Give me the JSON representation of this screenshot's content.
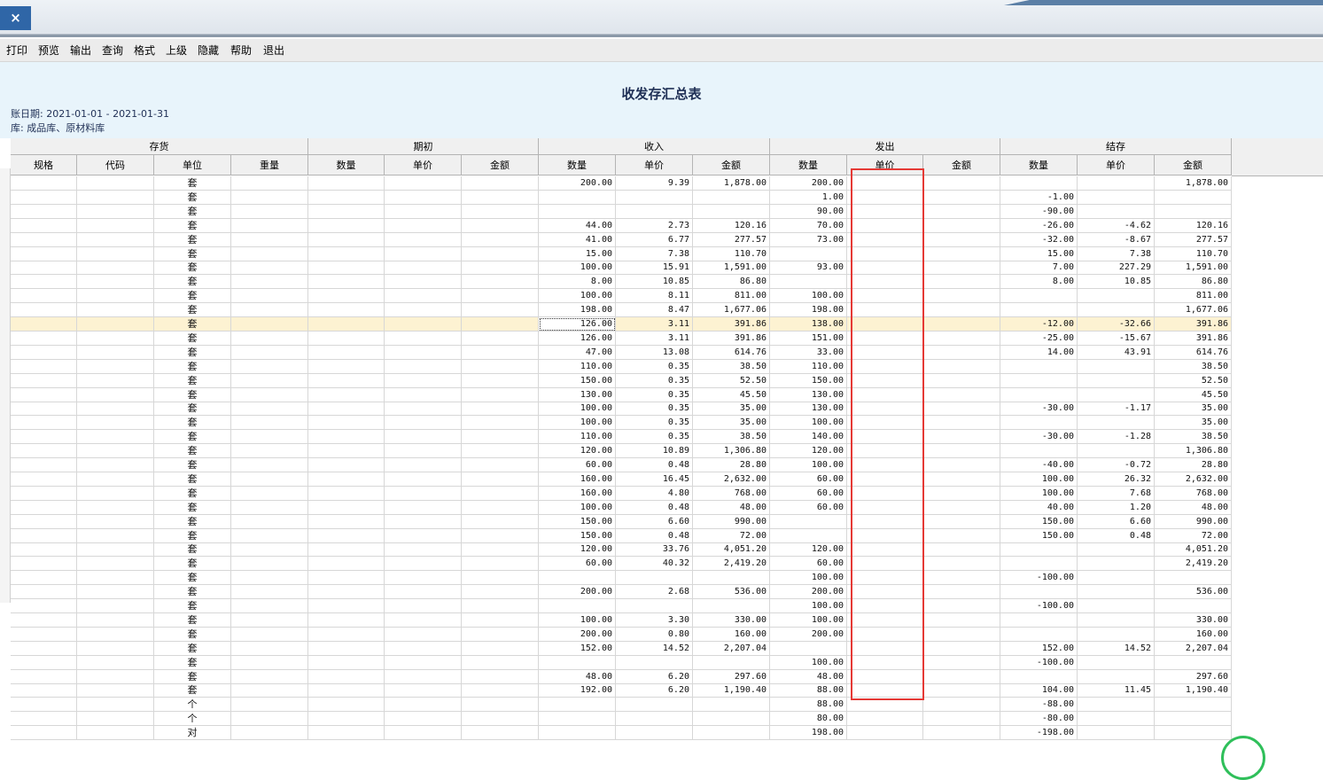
{
  "window": {
    "close_label": "×"
  },
  "toolbar": [
    {
      "label": "打印",
      "name": "toolbar-print"
    },
    {
      "label": "预览",
      "name": "toolbar-preview"
    },
    {
      "label": "输出",
      "name": "toolbar-export"
    },
    {
      "label": "查询",
      "name": "toolbar-query"
    },
    {
      "label": "格式",
      "name": "toolbar-format"
    },
    {
      "label": "上级",
      "name": "toolbar-parent"
    },
    {
      "label": "隐藏",
      "name": "toolbar-hide"
    },
    {
      "label": "帮助",
      "name": "toolbar-help"
    },
    {
      "label": "退出",
      "name": "toolbar-exit"
    }
  ],
  "report": {
    "title": "收发存汇总表",
    "date_line": "账日期: 2021-01-01 - 2021-01-31",
    "warehouse_line": "库: 成品库、原材料库"
  },
  "table": {
    "groups": [
      "存货",
      "期初",
      "收入",
      "发出",
      "结存"
    ],
    "columns": [
      "规格",
      "代码",
      "单位",
      "重量",
      "数量",
      "单价",
      "金额",
      "数量",
      "单价",
      "金额",
      "数量",
      "单价",
      "金额",
      "数量",
      "单价",
      "金额"
    ],
    "rows": [
      [
        "",
        "",
        "套",
        "",
        "",
        "",
        "",
        "200.00",
        "9.39",
        "1,878.00",
        "200.00",
        "",
        "",
        "",
        "",
        "1,878.00"
      ],
      [
        "",
        "",
        "套",
        "",
        "",
        "",
        "",
        "",
        "",
        "",
        "1.00",
        "",
        "",
        "-1.00",
        "",
        ""
      ],
      [
        "",
        "",
        "套",
        "",
        "",
        "",
        "",
        "",
        "",
        "",
        "90.00",
        "",
        "",
        "-90.00",
        "",
        ""
      ],
      [
        "",
        "",
        "套",
        "",
        "",
        "",
        "",
        "44.00",
        "2.73",
        "120.16",
        "70.00",
        "",
        "",
        "-26.00",
        "-4.62",
        "120.16"
      ],
      [
        "",
        "",
        "套",
        "",
        "",
        "",
        "",
        "41.00",
        "6.77",
        "277.57",
        "73.00",
        "",
        "",
        "-32.00",
        "-8.67",
        "277.57"
      ],
      [
        "",
        "",
        "套",
        "",
        "",
        "",
        "",
        "15.00",
        "7.38",
        "110.70",
        "",
        "",
        "",
        "15.00",
        "7.38",
        "110.70"
      ],
      [
        "",
        "",
        "套",
        "",
        "",
        "",
        "",
        "100.00",
        "15.91",
        "1,591.00",
        "93.00",
        "",
        "",
        "7.00",
        "227.29",
        "1,591.00"
      ],
      [
        "",
        "",
        "套",
        "",
        "",
        "",
        "",
        "8.00",
        "10.85",
        "86.80",
        "",
        "",
        "",
        "8.00",
        "10.85",
        "86.80"
      ],
      [
        "",
        "",
        "套",
        "",
        "",
        "",
        "",
        "100.00",
        "8.11",
        "811.00",
        "100.00",
        "",
        "",
        "",
        "",
        "811.00"
      ],
      [
        "",
        "",
        "套",
        "",
        "",
        "",
        "",
        "198.00",
        "8.47",
        "1,677.06",
        "198.00",
        "",
        "",
        "",
        "",
        "1,677.06"
      ],
      [
        "",
        "",
        "套",
        "",
        "",
        "",
        "",
        "126.00",
        "3.11",
        "391.86",
        "138.00",
        "",
        "",
        "-12.00",
        "-32.66",
        "391.86"
      ],
      [
        "",
        "",
        "套",
        "",
        "",
        "",
        "",
        "126.00",
        "3.11",
        "391.86",
        "151.00",
        "",
        "",
        "-25.00",
        "-15.67",
        "391.86"
      ],
      [
        "",
        "",
        "套",
        "",
        "",
        "",
        "",
        "47.00",
        "13.08",
        "614.76",
        "33.00",
        "",
        "",
        "14.00",
        "43.91",
        "614.76"
      ],
      [
        "",
        "",
        "套",
        "",
        "",
        "",
        "",
        "110.00",
        "0.35",
        "38.50",
        "110.00",
        "",
        "",
        "",
        "",
        "38.50"
      ],
      [
        "",
        "",
        "套",
        "",
        "",
        "",
        "",
        "150.00",
        "0.35",
        "52.50",
        "150.00",
        "",
        "",
        "",
        "",
        "52.50"
      ],
      [
        "",
        "",
        "套",
        "",
        "",
        "",
        "",
        "130.00",
        "0.35",
        "45.50",
        "130.00",
        "",
        "",
        "",
        "",
        "45.50"
      ],
      [
        "",
        "",
        "套",
        "",
        "",
        "",
        "",
        "100.00",
        "0.35",
        "35.00",
        "130.00",
        "",
        "",
        "-30.00",
        "-1.17",
        "35.00"
      ],
      [
        "",
        "",
        "套",
        "",
        "",
        "",
        "",
        "100.00",
        "0.35",
        "35.00",
        "100.00",
        "",
        "",
        "",
        "",
        "35.00"
      ],
      [
        "",
        "",
        "套",
        "",
        "",
        "",
        "",
        "110.00",
        "0.35",
        "38.50",
        "140.00",
        "",
        "",
        "-30.00",
        "-1.28",
        "38.50"
      ],
      [
        "",
        "",
        "套",
        "",
        "",
        "",
        "",
        "120.00",
        "10.89",
        "1,306.80",
        "120.00",
        "",
        "",
        "",
        "",
        "1,306.80"
      ],
      [
        "",
        "",
        "套",
        "",
        "",
        "",
        "",
        "60.00",
        "0.48",
        "28.80",
        "100.00",
        "",
        "",
        "-40.00",
        "-0.72",
        "28.80"
      ],
      [
        "",
        "",
        "套",
        "",
        "",
        "",
        "",
        "160.00",
        "16.45",
        "2,632.00",
        "60.00",
        "",
        "",
        "100.00",
        "26.32",
        "2,632.00"
      ],
      [
        "",
        "",
        "套",
        "",
        "",
        "",
        "",
        "160.00",
        "4.80",
        "768.00",
        "60.00",
        "",
        "",
        "100.00",
        "7.68",
        "768.00"
      ],
      [
        "",
        "",
        "套",
        "",
        "",
        "",
        "",
        "100.00",
        "0.48",
        "48.00",
        "60.00",
        "",
        "",
        "40.00",
        "1.20",
        "48.00"
      ],
      [
        "",
        "",
        "套",
        "",
        "",
        "",
        "",
        "150.00",
        "6.60",
        "990.00",
        "",
        "",
        "",
        "150.00",
        "6.60",
        "990.00"
      ],
      [
        "",
        "",
        "套",
        "",
        "",
        "",
        "",
        "150.00",
        "0.48",
        "72.00",
        "",
        "",
        "",
        "150.00",
        "0.48",
        "72.00"
      ],
      [
        "",
        "",
        "套",
        "",
        "",
        "",
        "",
        "120.00",
        "33.76",
        "4,051.20",
        "120.00",
        "",
        "",
        "",
        "",
        "4,051.20"
      ],
      [
        "",
        "",
        "套",
        "",
        "",
        "",
        "",
        "60.00",
        "40.32",
        "2,419.20",
        "60.00",
        "",
        "",
        "",
        "",
        "2,419.20"
      ],
      [
        "",
        "",
        "套",
        "",
        "",
        "",
        "",
        "",
        "",
        "",
        "100.00",
        "",
        "",
        "-100.00",
        "",
        ""
      ],
      [
        "",
        "",
        "套",
        "",
        "",
        "",
        "",
        "200.00",
        "2.68",
        "536.00",
        "200.00",
        "",
        "",
        "",
        "",
        "536.00"
      ],
      [
        "",
        "",
        "套",
        "",
        "",
        "",
        "",
        "",
        "",
        "",
        "100.00",
        "",
        "",
        "-100.00",
        "",
        ""
      ],
      [
        "",
        "",
        "套",
        "",
        "",
        "",
        "",
        "100.00",
        "3.30",
        "330.00",
        "100.00",
        "",
        "",
        "",
        "",
        "330.00"
      ],
      [
        "",
        "",
        "套",
        "",
        "",
        "",
        "",
        "200.00",
        "0.80",
        "160.00",
        "200.00",
        "",
        "",
        "",
        "",
        "160.00"
      ],
      [
        "",
        "",
        "套",
        "",
        "",
        "",
        "",
        "152.00",
        "14.52",
        "2,207.04",
        "",
        "",
        "",
        "152.00",
        "14.52",
        "2,207.04"
      ],
      [
        "",
        "",
        "套",
        "",
        "",
        "",
        "",
        "",
        "",
        "",
        "100.00",
        "",
        "",
        "-100.00",
        "",
        ""
      ],
      [
        "",
        "",
        "套",
        "",
        "",
        "",
        "",
        "48.00",
        "6.20",
        "297.60",
        "48.00",
        "",
        "",
        "",
        "",
        "297.60"
      ],
      [
        "",
        "",
        "套",
        "",
        "",
        "",
        "",
        "192.00",
        "6.20",
        "1,190.40",
        "88.00",
        "",
        "",
        "104.00",
        "11.45",
        "1,190.40"
      ],
      [
        "",
        "",
        "个",
        "",
        "",
        "",
        "",
        "",
        "",
        "",
        "88.00",
        "",
        "",
        "-88.00",
        "",
        ""
      ],
      [
        "",
        "",
        "个",
        "",
        "",
        "",
        "",
        "",
        "",
        "",
        "80.00",
        "",
        "",
        "-80.00",
        "",
        ""
      ],
      [
        "",
        "",
        "对",
        "",
        "",
        "",
        "",
        "",
        "",
        "",
        "198.00",
        "",
        "",
        "-198.00",
        "",
        ""
      ]
    ]
  },
  "colors": {
    "highlight_box": "#e53935",
    "selected_row": "#fdf2d2",
    "header_bg": "#e8f4fb"
  }
}
